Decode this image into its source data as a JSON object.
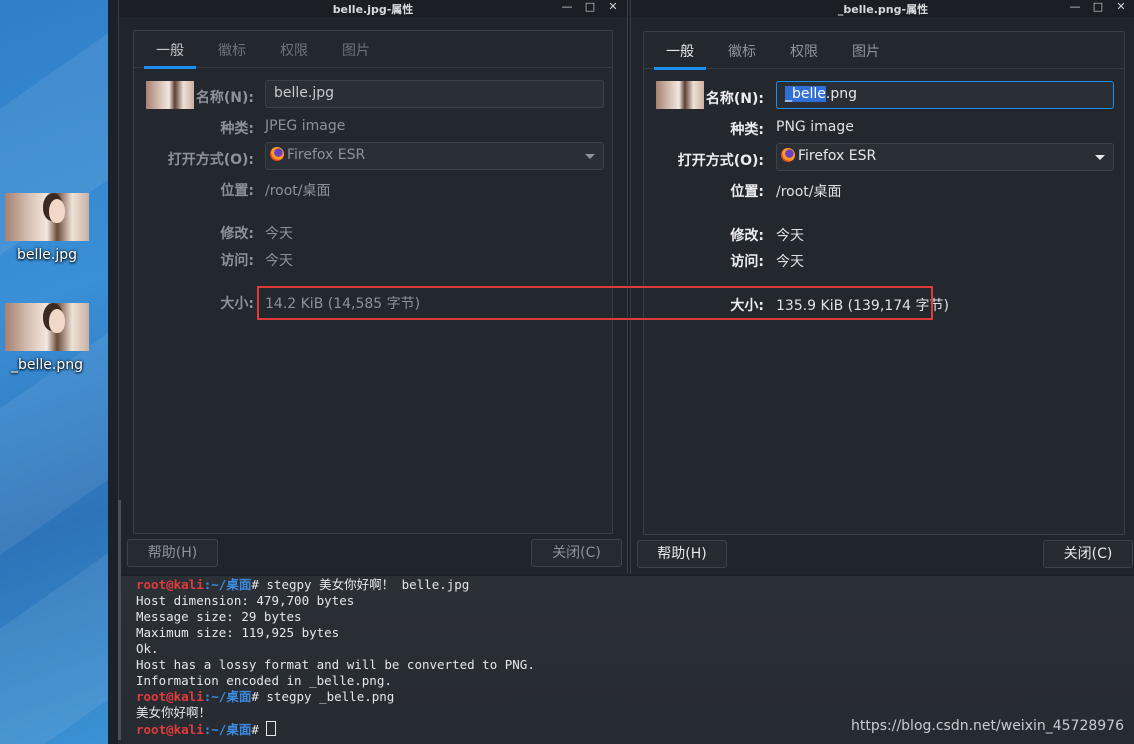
{
  "desktop": {
    "icons": [
      {
        "label": "belle.jpg"
      },
      {
        "label": "_belle.png"
      }
    ]
  },
  "window1": {
    "title": "belle.jpg-属性",
    "controls": {
      "minimize": "—",
      "maximize": "□",
      "close": "✕"
    },
    "tabs": [
      {
        "label": "一般"
      },
      {
        "label": "徽标"
      },
      {
        "label": "权限"
      },
      {
        "label": "图片"
      }
    ],
    "name_label": "名称(N):",
    "name_value": "belle.jpg",
    "type_label": "种类:",
    "type_value": "JPEG image",
    "open_with_label": "打开方式(O):",
    "open_with_value": "Firefox ESR",
    "location_label": "位置:",
    "location_value": "/root/桌面",
    "modified_label": "修改:",
    "modified_value": "今天",
    "accessed_label": "访问:",
    "accessed_value": "今天",
    "size_label": "大小:",
    "size_value": "14.2 KiB (14,585 字节)",
    "help_button": "帮助(H)",
    "close_button": "关闭(C)"
  },
  "window2": {
    "title": "_belle.png-属性",
    "controls": {
      "minimize": "—",
      "maximize": "□",
      "close": "✕"
    },
    "tabs": [
      {
        "label": "一般"
      },
      {
        "label": "徽标"
      },
      {
        "label": "权限"
      },
      {
        "label": "图片"
      }
    ],
    "name_label": "名称(N):",
    "name_selected": "_belle",
    "name_rest": ".png",
    "type_label": "种类:",
    "type_value": "PNG image",
    "open_with_label": "打开方式(O):",
    "open_with_value": "Firefox ESR",
    "location_label": "位置:",
    "location_value": "/root/桌面",
    "modified_label": "修改:",
    "modified_value": "今天",
    "accessed_label": "访问:",
    "accessed_value": "今天",
    "size_label": "大小:",
    "size_value": "135.9 KiB (139,174 字节)",
    "help_button": "帮助(H)",
    "close_button": "关闭(C)"
  },
  "terminal": {
    "prompt_user": "root@kali",
    "prompt_sep": ":",
    "prompt_path": "~/桌面",
    "prompt_symbol": "# ",
    "command1": "stegpy 美女你好啊！ belle.jpg",
    "output1": [
      "Host dimension: 479,700 bytes",
      "Message size: 29 bytes",
      "Maximum size: 119,925 bytes",
      "Ok.",
      "Host has a lossy format and will be converted to PNG.",
      "Information encoded in _belle.png."
    ],
    "command2": "stegpy _belle.png",
    "output2": [
      "美女你好啊！"
    ]
  },
  "watermark": "https://blog.csdn.net/weixin_45728976",
  "colors": {
    "highlight_box": "#e03a3a",
    "accent": "#1d8ef0",
    "prompt_user": "#e23b3b",
    "prompt_path": "#3d8be0"
  }
}
